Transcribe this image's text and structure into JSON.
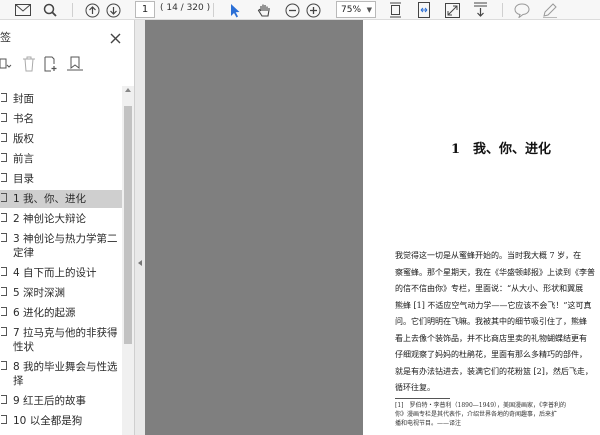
{
  "toolbar": {
    "page_current": "1",
    "page_total": "( 14 / 320 )",
    "zoom": "75%",
    "icons": [
      "mail-icon",
      "search-icon",
      "page-up-icon",
      "page-down-icon",
      "select-arrow-icon",
      "hand-icon",
      "zoom-out-icon",
      "zoom-in-icon",
      "fit-page-icon",
      "fit-width-icon",
      "fullscreen-icon",
      "scroll-icon",
      "comment-icon",
      "pen-icon"
    ]
  },
  "sidebar": {
    "title": "签",
    "outline": [
      {
        "label": "封面"
      },
      {
        "label": "书名"
      },
      {
        "label": "版权"
      },
      {
        "label": "前言"
      },
      {
        "label": "目录"
      },
      {
        "label": "1 我、你、进化"
      },
      {
        "label": "2 神创论大辩论"
      },
      {
        "label": "3 神创论与热力学第二定律"
      },
      {
        "label": "4 自下而上的设计"
      },
      {
        "label": "5 深时深渊"
      },
      {
        "label": "6 进化的起源"
      },
      {
        "label": "7 拉马克与他的非获得性状"
      },
      {
        "label": "8 我的毕业舞会与性选择"
      },
      {
        "label": "9 红王后的故事"
      },
      {
        "label": "10 以全都是狗"
      }
    ],
    "selected_index": 5
  },
  "document": {
    "chapter_title": "1　我、你、进化",
    "paragraphs": [
      "我觉得这一切是从蜜蜂开始的。当时我大概 7 岁，在",
      "察蜜蜂。那个星期天，我在《华盛顿邮报》上读到《李普",
      "的信不信由你》专栏，里面说：“从大小、形状和翼展",
      "熊蜂 [1] 不适应空气动力学——它应该不会飞！”这可真",
      "问。它们明明在飞嘛。我被其中的细节吸引住了，熊蜂",
      "看上去像个装饰品，并不比商店里卖的礼物蝴蝶结更有",
      "仔细观察了妈妈的杜鹃花，里面有那么多精巧的部件，",
      "就是有办法钻进去，装满它们的花粉篮 [2]，然后飞走，",
      "循环往复。"
    ],
    "footnote": [
      "[1]　罗伯特・李普利（1890—1949），美国漫画家，《李普利的",
      "你》漫画专栏是其代表作，介绍世界各地的奇闻趣事，后来扩",
      "播和电视节目。——译注"
    ]
  }
}
